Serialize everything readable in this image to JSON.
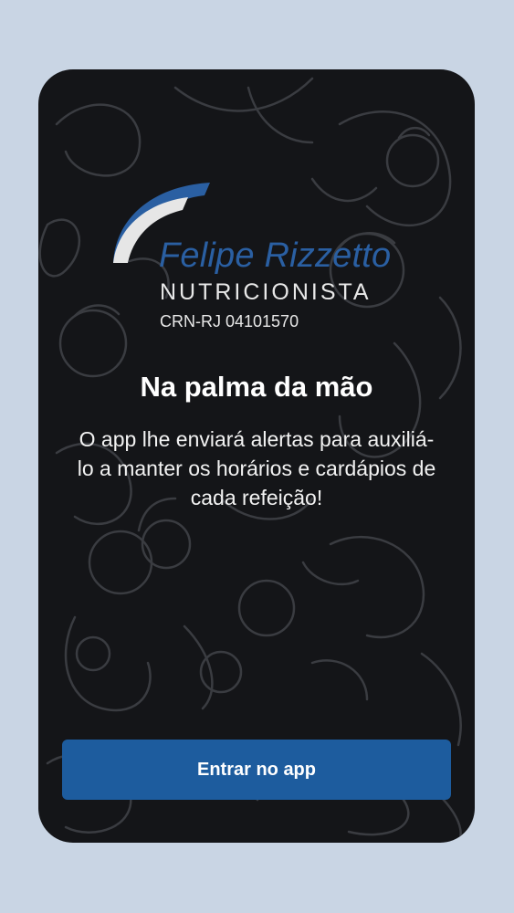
{
  "colors": {
    "page_background": "#c9d5e4",
    "card_background": "#141518",
    "accent_blue": "#1d5c9e",
    "logo_blue": "#2a5fa2",
    "text_white": "#ffffff"
  },
  "brand": {
    "logo_icon": "arc-logo-icon",
    "name": "Felipe Rizzetto",
    "subtitle": "NUTRICIONISTA",
    "registration": "CRN-RJ 04101570"
  },
  "intro": {
    "title": "Na palma da mão",
    "description": "O app lhe enviará alertas para auxiliá-lo a manter os horários e cardápios de cada refeição!"
  },
  "actions": {
    "enter_label": "Entrar no app"
  }
}
